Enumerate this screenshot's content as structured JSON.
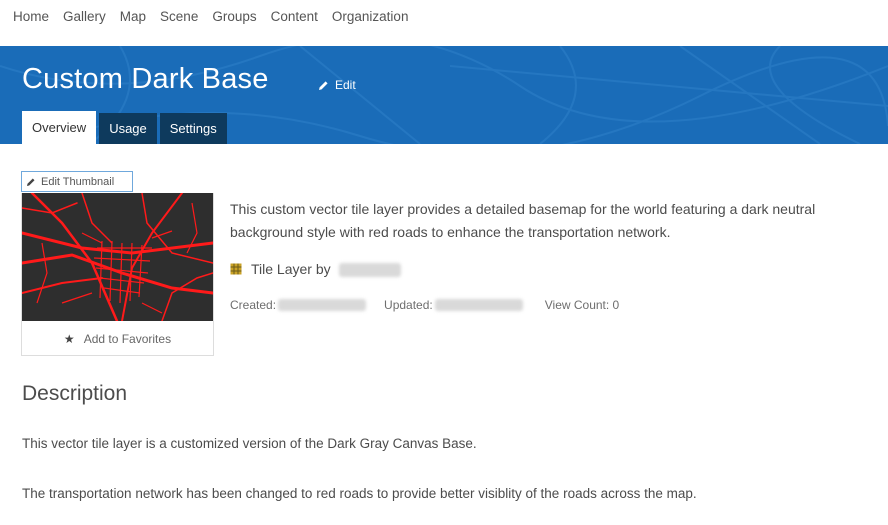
{
  "nav": [
    "Home",
    "Gallery",
    "Map",
    "Scene",
    "Groups",
    "Content",
    "Organization"
  ],
  "item": {
    "title": "Custom Dark Base",
    "edit_label": "Edit",
    "tabs": [
      "Overview",
      "Usage",
      "Settings"
    ],
    "active_tab": "Overview"
  },
  "thumbnail": {
    "edit_label": "Edit Thumbnail",
    "favorites_label": "Add to Favorites"
  },
  "summary": {
    "text": "This custom vector tile layer provides a detailed basemap for the world featuring a dark neutral background style with red roads to enhance the transportation network.",
    "layer_type": "Tile Layer by",
    "owner": "",
    "created_label": "Created:",
    "created_value": "",
    "updated_label": "Updated:",
    "updated_value": "",
    "view_count": "View Count: 0"
  },
  "description": {
    "heading": "Description",
    "paragraphs": [
      "This vector tile layer is a customized version of the Dark Gray Canvas Base.",
      "The transportation network has been changed to red roads to provide better visiblity of the roads across the map."
    ]
  },
  "colors": {
    "banner": "#1a6cb8",
    "tab_dark": "#0e3a5d",
    "roads": "#ff1a1a",
    "thumbnail_bg": "#2e2e2e"
  }
}
